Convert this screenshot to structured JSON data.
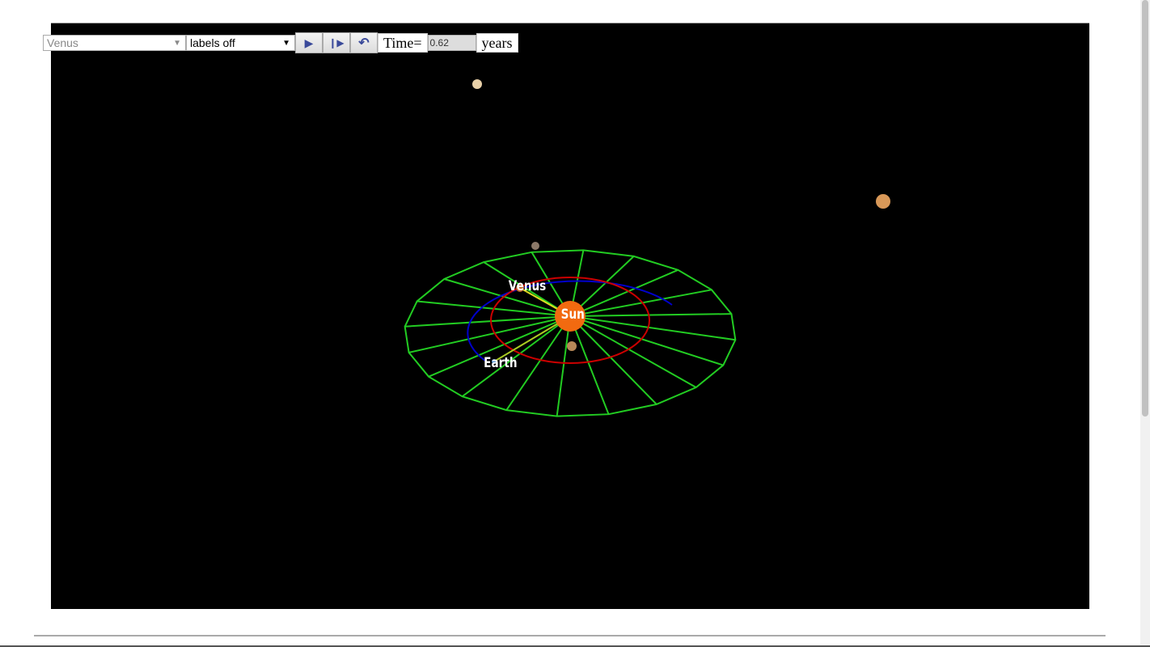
{
  "toolbar": {
    "planet_select": "Venus",
    "labels_select": "labels off",
    "play_button": "play",
    "step_button": "step",
    "reset_button": "reset",
    "time_label": "Time=",
    "time_value": "0.62",
    "time_unit": "years"
  },
  "scene": {
    "labels": {
      "sun": "Sun",
      "venus": "Venus",
      "earth": "Earth"
    },
    "colors": {
      "grid": "#22cc22",
      "venus_orbit": "#cc0000",
      "earth_orbit": "#0000cc",
      "sun": "#f26a10"
    }
  }
}
